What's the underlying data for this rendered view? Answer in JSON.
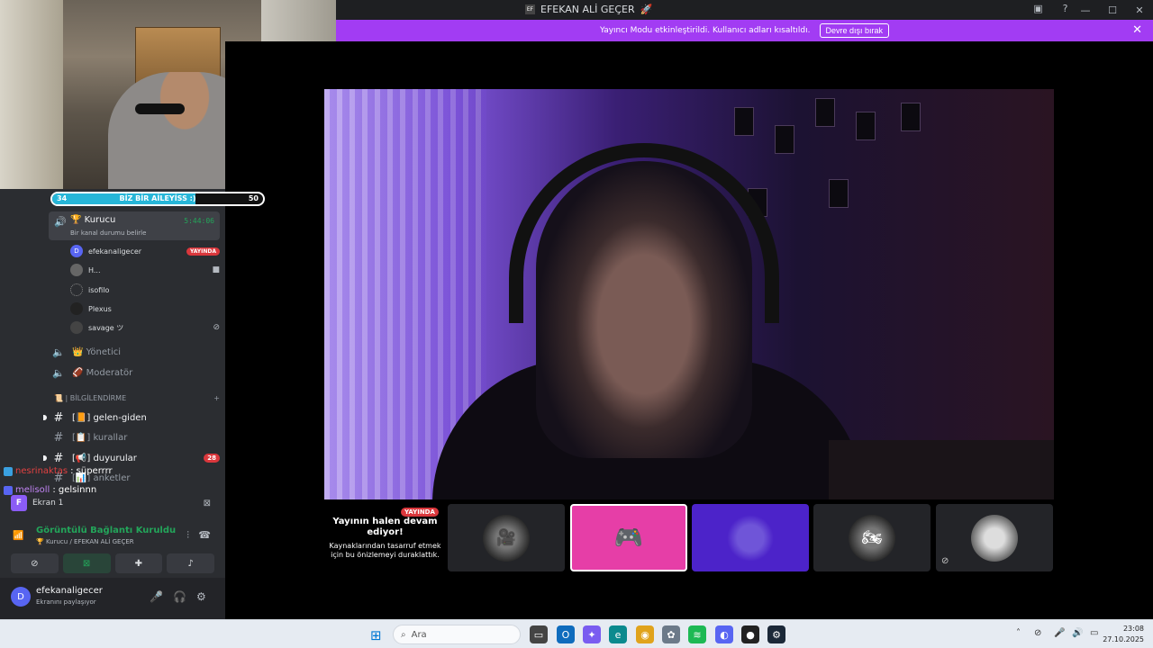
{
  "window": {
    "title": "EFEKAN ALİ GEÇER",
    "title_badge": "EF",
    "controls": {
      "minimize": "—",
      "maximize": "☐",
      "close": "✕"
    }
  },
  "banner": {
    "message": "Yayıncı Modu etkinleştirildi. Kullanıcı adları kısaltıldı.",
    "button": "Devre dışı bırak",
    "close": "✕"
  },
  "progress_bar": {
    "left_value": "34",
    "label": "BİZ BİR AİLEYİSS :)",
    "right_value": "50",
    "fraction": 0.68
  },
  "voice_channel": {
    "name": "Kurucu",
    "emoji": "🏆",
    "timer": "5:44:06",
    "status": "Bir kanal durumu belirle"
  },
  "members": [
    {
      "name": "efekanaligecer",
      "badge": "YAYINDA",
      "right_icon": ""
    },
    {
      "name": "H...",
      "badge": "",
      "right_icon": "camera-icon"
    },
    {
      "name": "isofilo",
      "badge": "",
      "right_icon": ""
    },
    {
      "name": "Plexus",
      "badge": "",
      "right_icon": ""
    },
    {
      "name": "savage ツ",
      "badge": "",
      "right_icon": "deafened-icon"
    }
  ],
  "voice_channels": [
    {
      "emoji": "👑",
      "name": "Yönetici"
    },
    {
      "emoji": "🏈",
      "name": "Moderatör"
    }
  ],
  "category": {
    "name": "📜 | BİLGİLENDİRME",
    "add": "+"
  },
  "text_channels": [
    {
      "name": "gelen-giden",
      "prefix": "[📙]",
      "unread": true,
      "count": ""
    },
    {
      "name": "kurallar",
      "prefix": "[📋]",
      "unread": false,
      "count": ""
    },
    {
      "name": "duyurular",
      "prefix": "[📢]",
      "unread": true,
      "count": "28"
    },
    {
      "name": "anketler",
      "prefix": "[📊]",
      "unread": false,
      "count": ""
    }
  ],
  "chat_overlay": [
    {
      "user": "nesrinaktas",
      "message": ": süperrrr"
    },
    {
      "user": "melisoll",
      "message": ": gelsinnn"
    }
  ],
  "screen_share": {
    "avatar": "F",
    "label": "Ekran 1"
  },
  "voice_connection": {
    "title": "Görüntülü Bağlantı Kuruldu",
    "subtitle": "🏆 Kurucu / EFEKAN ALİ GEÇER"
  },
  "user": {
    "name": "efekanaligecer",
    "status": "Ekranını paylaşıyor"
  },
  "stream_panel": {
    "live_badge": "YAYINDA",
    "heading": "Yayının halen devam ediyor!",
    "sub": "Kaynaklarından tasarruf etmek için bu önizlemeyi duraklattık."
  },
  "taskbar": {
    "search_placeholder": "Ara",
    "time": "23:08",
    "date": "27.10.2025"
  },
  "colors": {
    "banner": "#a23cf3",
    "live": "#da373c",
    "connected": "#23a55a",
    "selected_tile": "#e63ea7",
    "purple_tile": "#4c23c9"
  }
}
